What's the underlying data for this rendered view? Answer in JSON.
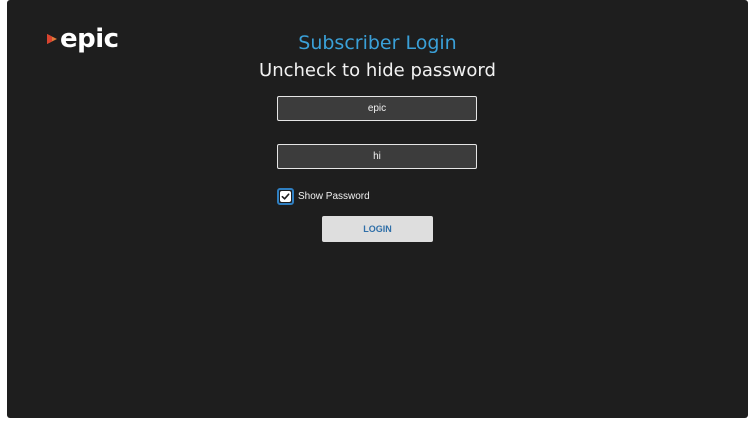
{
  "app": {
    "logo_text": "epic",
    "logo_mark": "play-triangle-logo",
    "accent_color": "#3aa0d8"
  },
  "header": {
    "title": "Subscriber Login",
    "subtitle": "Uncheck to hide password"
  },
  "form": {
    "username_value": "epic",
    "password_value": "hi",
    "show_password_label": "Show Password",
    "show_password_checked": true,
    "login_label": "LOGIN"
  }
}
